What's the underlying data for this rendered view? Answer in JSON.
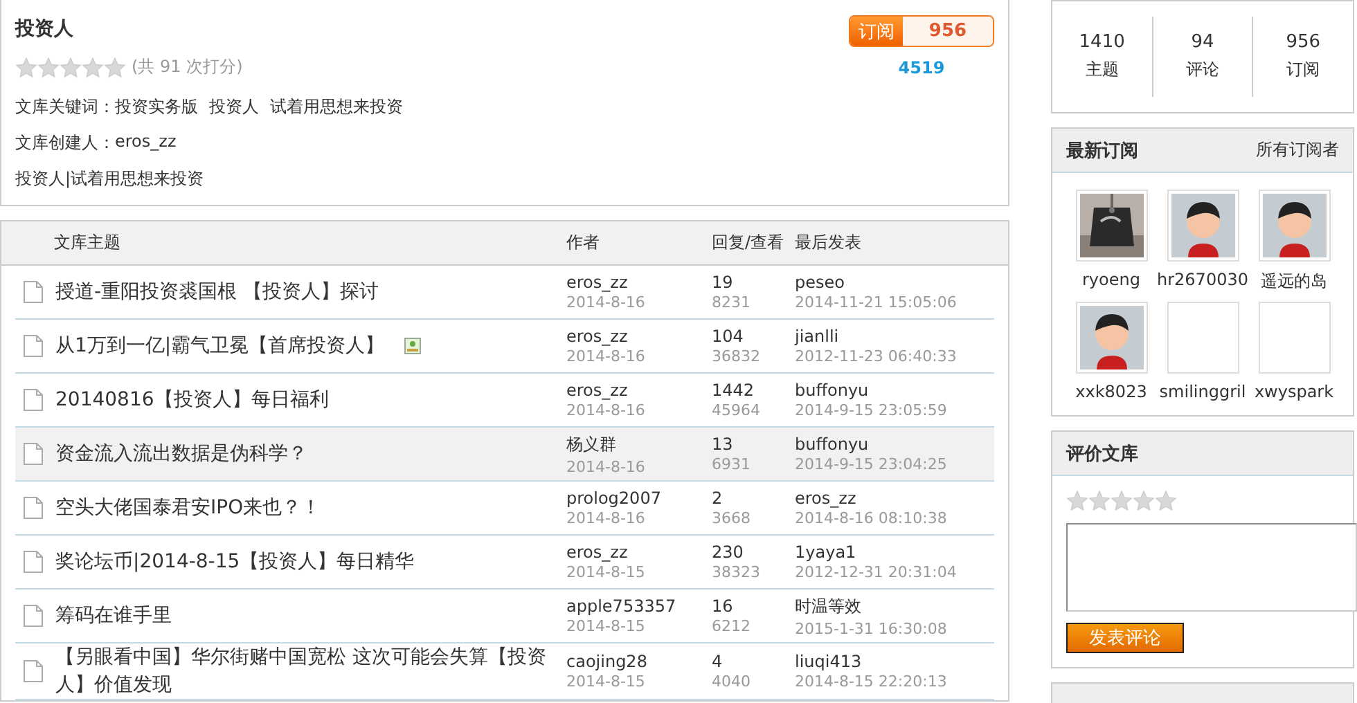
{
  "library": {
    "title": "投资人",
    "stars": 0,
    "rating_count": "(共  91 次打分)",
    "subscribe_label": "订阅",
    "subscribe_count": "956",
    "views": "4519",
    "keywords_label": "文库关键词：",
    "keywords": [
      "投资实务版",
      "投资人",
      "试着用思想来投资"
    ],
    "creator_label": "文库创建人：",
    "creator": "eros_zz",
    "description": "投资人|试着用思想来投资"
  },
  "table": {
    "columns": [
      "文库主题",
      "作者",
      "回复/查看",
      "最后发表"
    ],
    "rows": [
      {
        "title": "授道-重阳投资裘国根 【投资人】探讨",
        "has_image": false,
        "highlighted": false,
        "author": "eros_zz",
        "date": "2014-8-16",
        "replies": "19",
        "views": "8231",
        "last_user": "peseo",
        "last_time": "2014-11-21 15:05:06"
      },
      {
        "title": "从1万到一亿|霸气卫冕【首席投资人】",
        "has_image": true,
        "highlighted": false,
        "author": "eros_zz",
        "date": "2014-8-16",
        "replies": "104",
        "views": "36832",
        "last_user": "jianlli",
        "last_time": "2012-11-23 06:40:33"
      },
      {
        "title": "20140816【投资人】每日福利",
        "has_image": false,
        "highlighted": false,
        "author": "eros_zz",
        "date": "2014-8-16",
        "replies": "1442",
        "views": "45964",
        "last_user": "buffonyu",
        "last_time": "2014-9-15 23:05:59"
      },
      {
        "title": "资金流入流出数据是伪科学？",
        "has_image": false,
        "highlighted": true,
        "author": "杨义群",
        "date": "2014-8-16",
        "replies": "13",
        "views": "6931",
        "last_user": "buffonyu",
        "last_time": "2014-9-15 23:04:25"
      },
      {
        "title": "空头大佬国泰君安IPO来也？！",
        "has_image": false,
        "highlighted": false,
        "author": "prolog2007",
        "date": "2014-8-16",
        "replies": "2",
        "views": "3668",
        "last_user": "eros_zz",
        "last_time": "2014-8-16 08:10:38"
      },
      {
        "title": "奖论坛币|2014-8-15【投资人】每日精华",
        "has_image": false,
        "highlighted": false,
        "author": "eros_zz",
        "date": "2014-8-15",
        "replies": "230",
        "views": "38323",
        "last_user": "1yaya1",
        "last_time": "2012-12-31 20:31:04"
      },
      {
        "title": "筹码在谁手里",
        "has_image": false,
        "highlighted": false,
        "author": "apple753357",
        "date": "2014-8-15",
        "replies": "16",
        "views": "6212",
        "last_user": "时温等效",
        "last_time": "2015-1-31 16:30:08"
      },
      {
        "title": "【另眼看中国】华尔街赌中国宽松 这次可能会失算【投资人】价值发现",
        "has_image": false,
        "highlighted": false,
        "author": "caojing28",
        "date": "2014-8-15",
        "replies": "4",
        "views": "4040",
        "last_user": "liuqi413",
        "last_time": "2014-8-15 22:20:13"
      }
    ]
  },
  "stats": [
    {
      "value": "1410",
      "label": "主题"
    },
    {
      "value": "94",
      "label": "评论"
    },
    {
      "value": "956",
      "label": "订阅"
    }
  ],
  "subscribers": {
    "title": "最新订阅",
    "link": "所有订阅者",
    "items": [
      {
        "name": "ryoeng",
        "kind": "picture"
      },
      {
        "name": "hr2670030",
        "kind": "avatar"
      },
      {
        "name": "遥远的岛",
        "kind": "avatar"
      },
      {
        "name": "xxk8023",
        "kind": "avatar"
      },
      {
        "name": "smilinggril",
        "kind": "empty"
      },
      {
        "name": "xwyspark",
        "kind": "empty"
      }
    ]
  },
  "review": {
    "title": "评价文库",
    "stars": 0,
    "button": "发表评论"
  }
}
